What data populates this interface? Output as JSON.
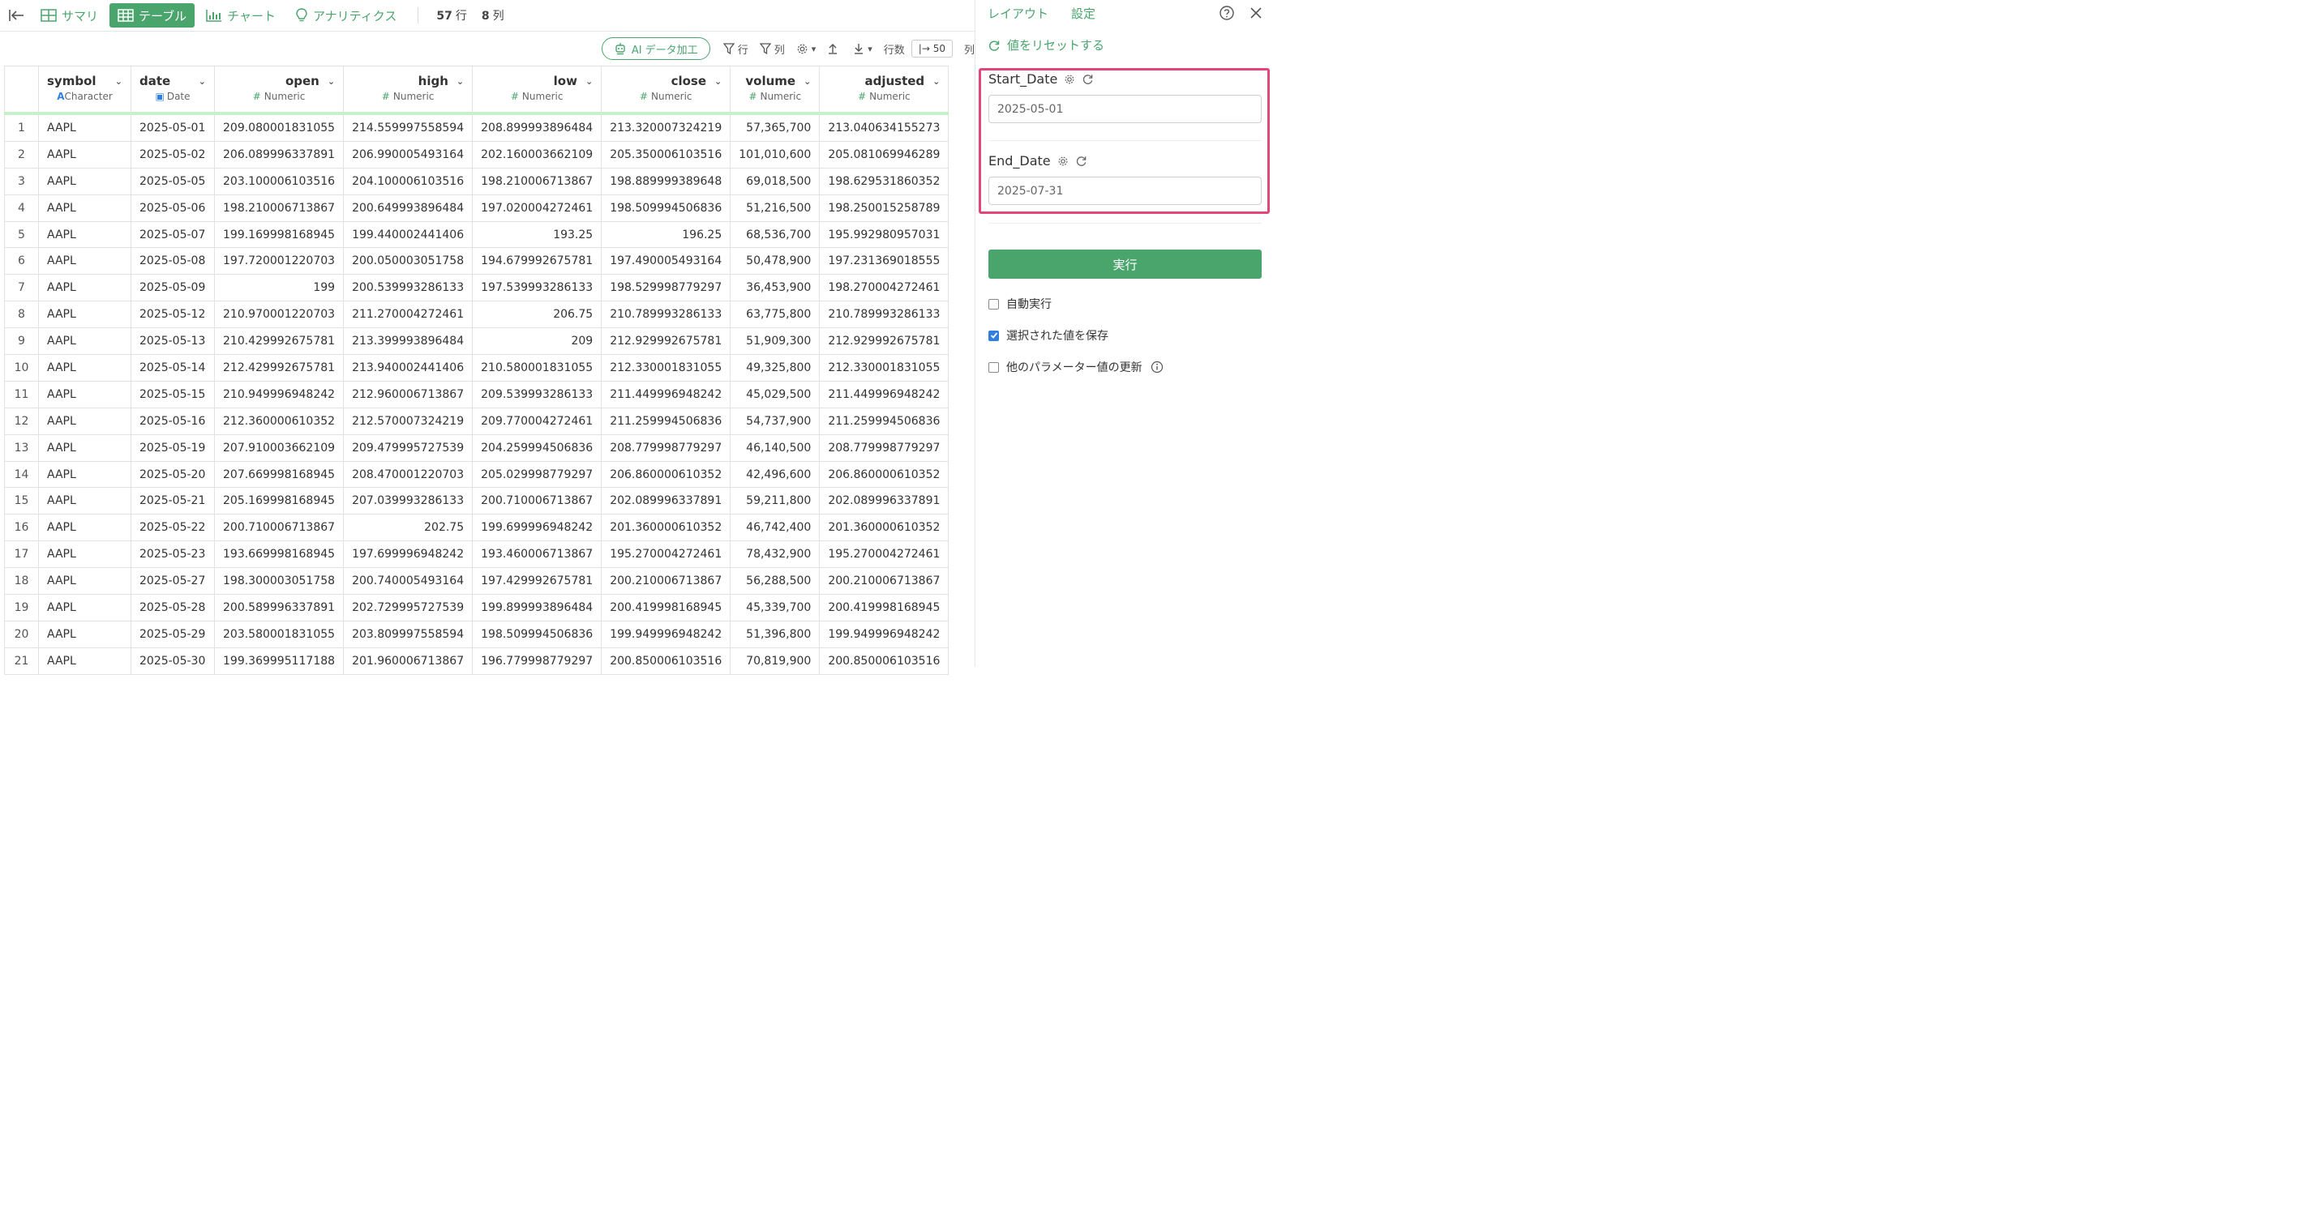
{
  "topbar": {
    "tabs": [
      {
        "label": "サマリ",
        "icon": "summary-icon"
      },
      {
        "label": "テーブル",
        "icon": "table-icon",
        "active": true
      },
      {
        "label": "チャート",
        "icon": "chart-icon"
      },
      {
        "label": "アナリティクス",
        "icon": "lightbulb-icon"
      }
    ],
    "row_count": "57",
    "row_unit": "行",
    "col_count": "8",
    "col_unit": "列"
  },
  "toolbar": {
    "ai_label": "AI データ加工",
    "filter_row_label": "行",
    "filter_col_label": "列",
    "rows_label": "行数",
    "rows_value": "|→ 50",
    "clipped_label": "列"
  },
  "table": {
    "columns": [
      {
        "name": "symbol",
        "type": "Character"
      },
      {
        "name": "date",
        "type": "Date"
      },
      {
        "name": "open",
        "type": "Numeric"
      },
      {
        "name": "high",
        "type": "Numeric"
      },
      {
        "name": "low",
        "type": "Numeric"
      },
      {
        "name": "close",
        "type": "Numeric"
      },
      {
        "name": "volume",
        "type": "Numeric"
      },
      {
        "name": "adjusted",
        "type": "Numeric"
      }
    ],
    "rows": [
      [
        "1",
        "AAPL",
        "2025-05-01",
        "209.080001831055",
        "214.559997558594",
        "208.899993896484",
        "213.320007324219",
        "57,365,700",
        "213.040634155273"
      ],
      [
        "2",
        "AAPL",
        "2025-05-02",
        "206.089996337891",
        "206.990005493164",
        "202.160003662109",
        "205.350006103516",
        "101,010,600",
        "205.081069946289"
      ],
      [
        "3",
        "AAPL",
        "2025-05-05",
        "203.100006103516",
        "204.100006103516",
        "198.210006713867",
        "198.889999389648",
        "69,018,500",
        "198.629531860352"
      ],
      [
        "4",
        "AAPL",
        "2025-05-06",
        "198.210006713867",
        "200.649993896484",
        "197.020004272461",
        "198.509994506836",
        "51,216,500",
        "198.250015258789"
      ],
      [
        "5",
        "AAPL",
        "2025-05-07",
        "199.169998168945",
        "199.440002441406",
        "193.25",
        "196.25",
        "68,536,700",
        "195.992980957031"
      ],
      [
        "6",
        "AAPL",
        "2025-05-08",
        "197.720001220703",
        "200.050003051758",
        "194.679992675781",
        "197.490005493164",
        "50,478,900",
        "197.231369018555"
      ],
      [
        "7",
        "AAPL",
        "2025-05-09",
        "199",
        "200.539993286133",
        "197.539993286133",
        "198.529998779297",
        "36,453,900",
        "198.270004272461"
      ],
      [
        "8",
        "AAPL",
        "2025-05-12",
        "210.970001220703",
        "211.270004272461",
        "206.75",
        "210.789993286133",
        "63,775,800",
        "210.789993286133"
      ],
      [
        "9",
        "AAPL",
        "2025-05-13",
        "210.429992675781",
        "213.399993896484",
        "209",
        "212.929992675781",
        "51,909,300",
        "212.929992675781"
      ],
      [
        "10",
        "AAPL",
        "2025-05-14",
        "212.429992675781",
        "213.940002441406",
        "210.580001831055",
        "212.330001831055",
        "49,325,800",
        "212.330001831055"
      ],
      [
        "11",
        "AAPL",
        "2025-05-15",
        "210.949996948242",
        "212.960006713867",
        "209.539993286133",
        "211.449996948242",
        "45,029,500",
        "211.449996948242"
      ],
      [
        "12",
        "AAPL",
        "2025-05-16",
        "212.360000610352",
        "212.570007324219",
        "209.770004272461",
        "211.259994506836",
        "54,737,900",
        "211.259994506836"
      ],
      [
        "13",
        "AAPL",
        "2025-05-19",
        "207.910003662109",
        "209.479995727539",
        "204.259994506836",
        "208.779998779297",
        "46,140,500",
        "208.779998779297"
      ],
      [
        "14",
        "AAPL",
        "2025-05-20",
        "207.669998168945",
        "208.470001220703",
        "205.029998779297",
        "206.860000610352",
        "42,496,600",
        "206.860000610352"
      ],
      [
        "15",
        "AAPL",
        "2025-05-21",
        "205.169998168945",
        "207.039993286133",
        "200.710006713867",
        "202.089996337891",
        "59,211,800",
        "202.089996337891"
      ],
      [
        "16",
        "AAPL",
        "2025-05-22",
        "200.710006713867",
        "202.75",
        "199.699996948242",
        "201.360000610352",
        "46,742,400",
        "201.360000610352"
      ],
      [
        "17",
        "AAPL",
        "2025-05-23",
        "193.669998168945",
        "197.699996948242",
        "193.460006713867",
        "195.270004272461",
        "78,432,900",
        "195.270004272461"
      ],
      [
        "18",
        "AAPL",
        "2025-05-27",
        "198.300003051758",
        "200.740005493164",
        "197.429992675781",
        "200.210006713867",
        "56,288,500",
        "200.210006713867"
      ],
      [
        "19",
        "AAPL",
        "2025-05-28",
        "200.589996337891",
        "202.729995727539",
        "199.899993896484",
        "200.419998168945",
        "45,339,700",
        "200.419998168945"
      ],
      [
        "20",
        "AAPL",
        "2025-05-29",
        "203.580001831055",
        "203.809997558594",
        "198.509994506836",
        "199.949996948242",
        "51,396,800",
        "199.949996948242"
      ],
      [
        "21",
        "AAPL",
        "2025-05-30",
        "199.369995117188",
        "201.960006713867",
        "196.779998779297",
        "200.850006103516",
        "70,819,900",
        "200.850006103516"
      ]
    ]
  },
  "panel": {
    "tab_layout": "レイアウト",
    "tab_settings": "設定",
    "reset_label": "値をリセットする",
    "params": [
      {
        "label": "Start_Date",
        "value": "2025-05-01"
      },
      {
        "label": "End_Date",
        "value": "2025-07-31"
      }
    ],
    "run_label": "実行",
    "options": [
      {
        "label": "自動実行",
        "checked": false
      },
      {
        "label": "選択された値を保存",
        "checked": true
      },
      {
        "label": "他のパラメーター値の更新",
        "checked": false
      }
    ]
  },
  "colors": {
    "accent": "#4aa56d",
    "highlight": "#e4457a",
    "checkbox": "#2f7fe0",
    "header_underline": "#c9efc9"
  }
}
